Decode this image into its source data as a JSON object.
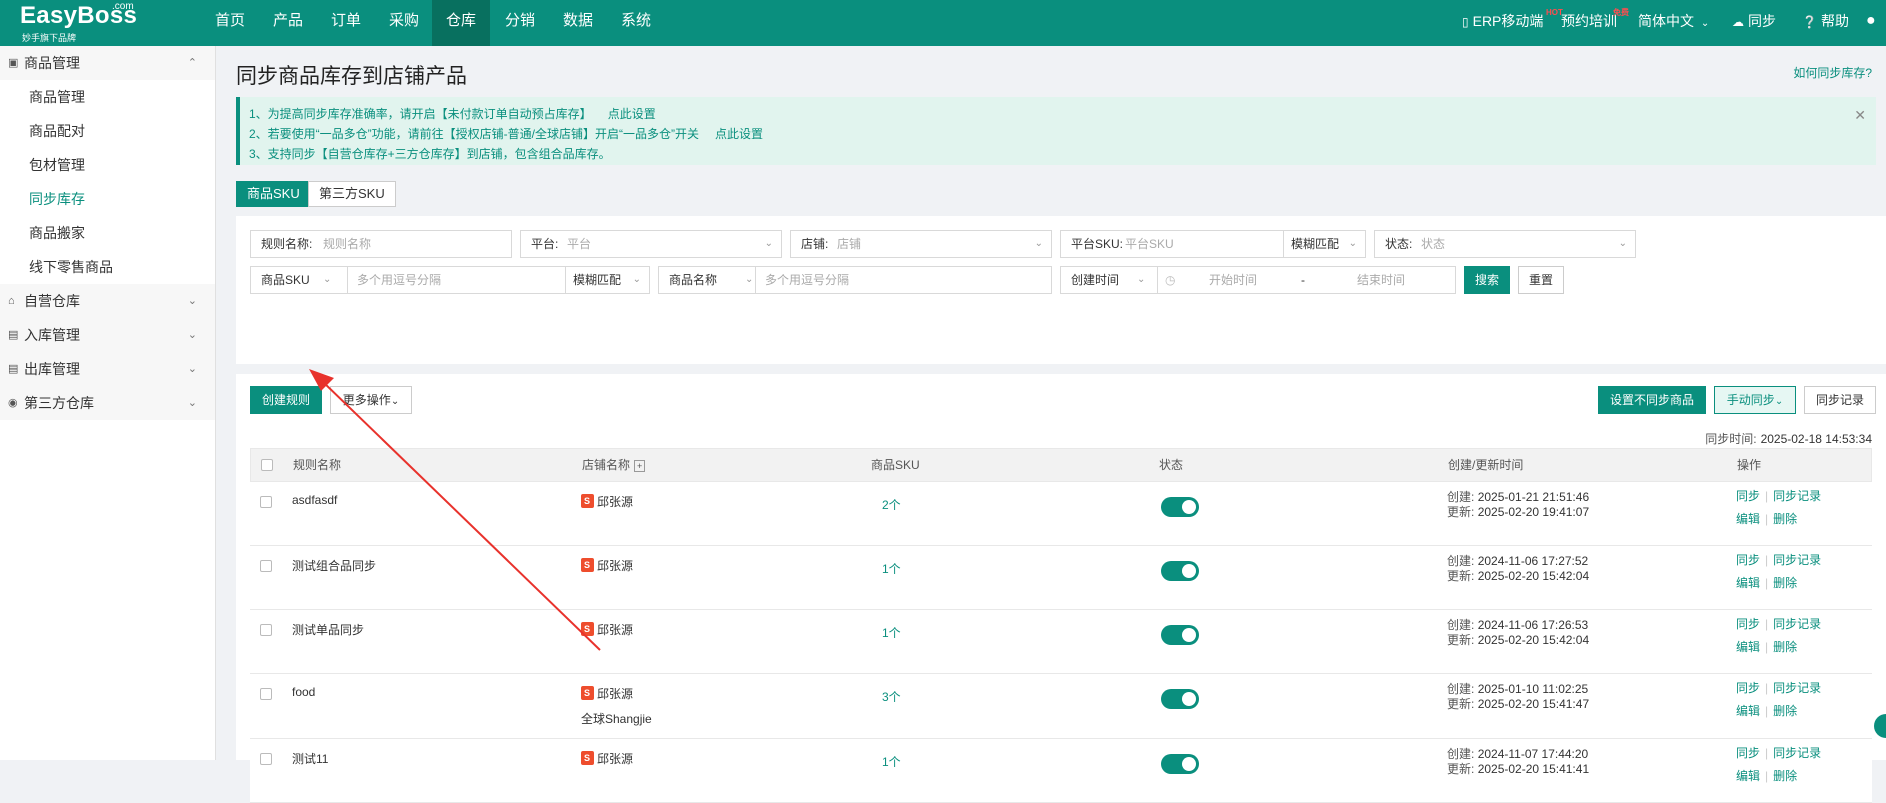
{
  "header": {
    "logo": {
      "main": "EasyBoss",
      "sub": "妙手旗下品牌",
      "dotcom": ".com"
    },
    "nav": [
      "首页",
      "产品",
      "订单",
      "采购",
      "仓库",
      "分销",
      "数据",
      "系统"
    ],
    "active_nav": "仓库",
    "right": {
      "mobile": "ERP移动端",
      "mobile_badge": "HOT",
      "training": "预约培训",
      "training_badge": "免费",
      "language": "简体中文",
      "sync": "同步",
      "help": "帮助"
    }
  },
  "sidebar": {
    "groups": [
      {
        "label": "商品管理",
        "expanded": true,
        "items": [
          "商品管理",
          "商品配对",
          "包材管理",
          "同步库存",
          "商品搬家",
          "线下零售商品"
        ]
      },
      {
        "label": "自营仓库",
        "expanded": false
      },
      {
        "label": "入库管理",
        "expanded": false
      },
      {
        "label": "出库管理",
        "expanded": false
      },
      {
        "label": "第三方仓库",
        "expanded": false
      }
    ],
    "active_item": "同步库存"
  },
  "page": {
    "title": "同步商品库存到店铺产品",
    "help_link": "如何同步库存?",
    "notices": [
      {
        "text": "1、为提高同步库存准确率，请开启【未付款订单自动预占库存】",
        "link": "点此设置"
      },
      {
        "text": "2、若要使用“一品多仓”功能，请前往【授权店铺-普通/全球店铺】开启“一品多仓”开关",
        "link": "点此设置"
      },
      {
        "text": "3、支持同步【自营仓库存+三方仓库存】到店铺，包含组合品库存。",
        "link": ""
      }
    ],
    "tabs": [
      "商品SKU",
      "第三方SKU"
    ]
  },
  "filters": {
    "rule_name": {
      "label": "规则名称:",
      "placeholder": "规则名称"
    },
    "platform": {
      "label": "平台:",
      "placeholder": "平台"
    },
    "store": {
      "label": "店铺:",
      "placeholder": "店铺"
    },
    "platform_sku": {
      "label": "平台SKU:",
      "placeholder": "平台SKU",
      "match": "模糊匹配"
    },
    "status": {
      "label": "状态:",
      "placeholder": "状态"
    },
    "product_sku": {
      "label": "商品SKU",
      "placeholder": "多个用逗号分隔",
      "match": "模糊匹配"
    },
    "product_name": {
      "label": "商品名称",
      "placeholder": "多个用逗号分隔"
    },
    "created_time": {
      "label": "创建时间",
      "start": "开始时间",
      "end": "结束时间",
      "sep": "-"
    },
    "search_btn": "搜索",
    "reset_btn": "重置"
  },
  "actions": {
    "create": "创建规则",
    "more": "更多操作",
    "set_no_sync": "设置不同步商品",
    "manual_sync": "手动同步",
    "sync_records": "同步记录",
    "sync_time_label": "同步时间:",
    "sync_time": "2025-02-18 14:53:34"
  },
  "table": {
    "headers": [
      "规则名称",
      "店铺名称",
      "商品SKU",
      "状态",
      "创建/更新时间",
      "操作"
    ],
    "rows": [
      {
        "name": "asdfasdf",
        "store": "邱张源",
        "store2": "",
        "sku": "2个",
        "created": "2025-01-21 21:51:46",
        "updated": "2025-02-20 19:41:07"
      },
      {
        "name": "测试组合品同步",
        "store": "邱张源",
        "store2": "",
        "sku": "1个",
        "created": "2024-11-06 17:27:52",
        "updated": "2025-02-20 15:42:04"
      },
      {
        "name": "测试单品同步",
        "store": "邱张源",
        "store2": "",
        "sku": "1个",
        "created": "2024-11-06 17:26:53",
        "updated": "2025-02-20 15:42:04"
      },
      {
        "name": "food",
        "store": "邱张源",
        "store2": "全球Shangjie",
        "sku": "3个",
        "created": "2025-01-10 11:02:25",
        "updated": "2025-02-20 15:41:47"
      },
      {
        "name": "测试11",
        "store": "邱张源",
        "store2": "",
        "sku": "1个",
        "created": "2024-11-07 17:44:20",
        "updated": "2025-02-20 15:41:41"
      }
    ],
    "created_label": "创建:",
    "updated_label": "更新:",
    "op_sync": "同步",
    "op_records": "同步记录",
    "op_edit": "编辑",
    "op_delete": "删除"
  },
  "colors": {
    "primary": "#0a8f7e",
    "annotation": "#e8322c"
  }
}
